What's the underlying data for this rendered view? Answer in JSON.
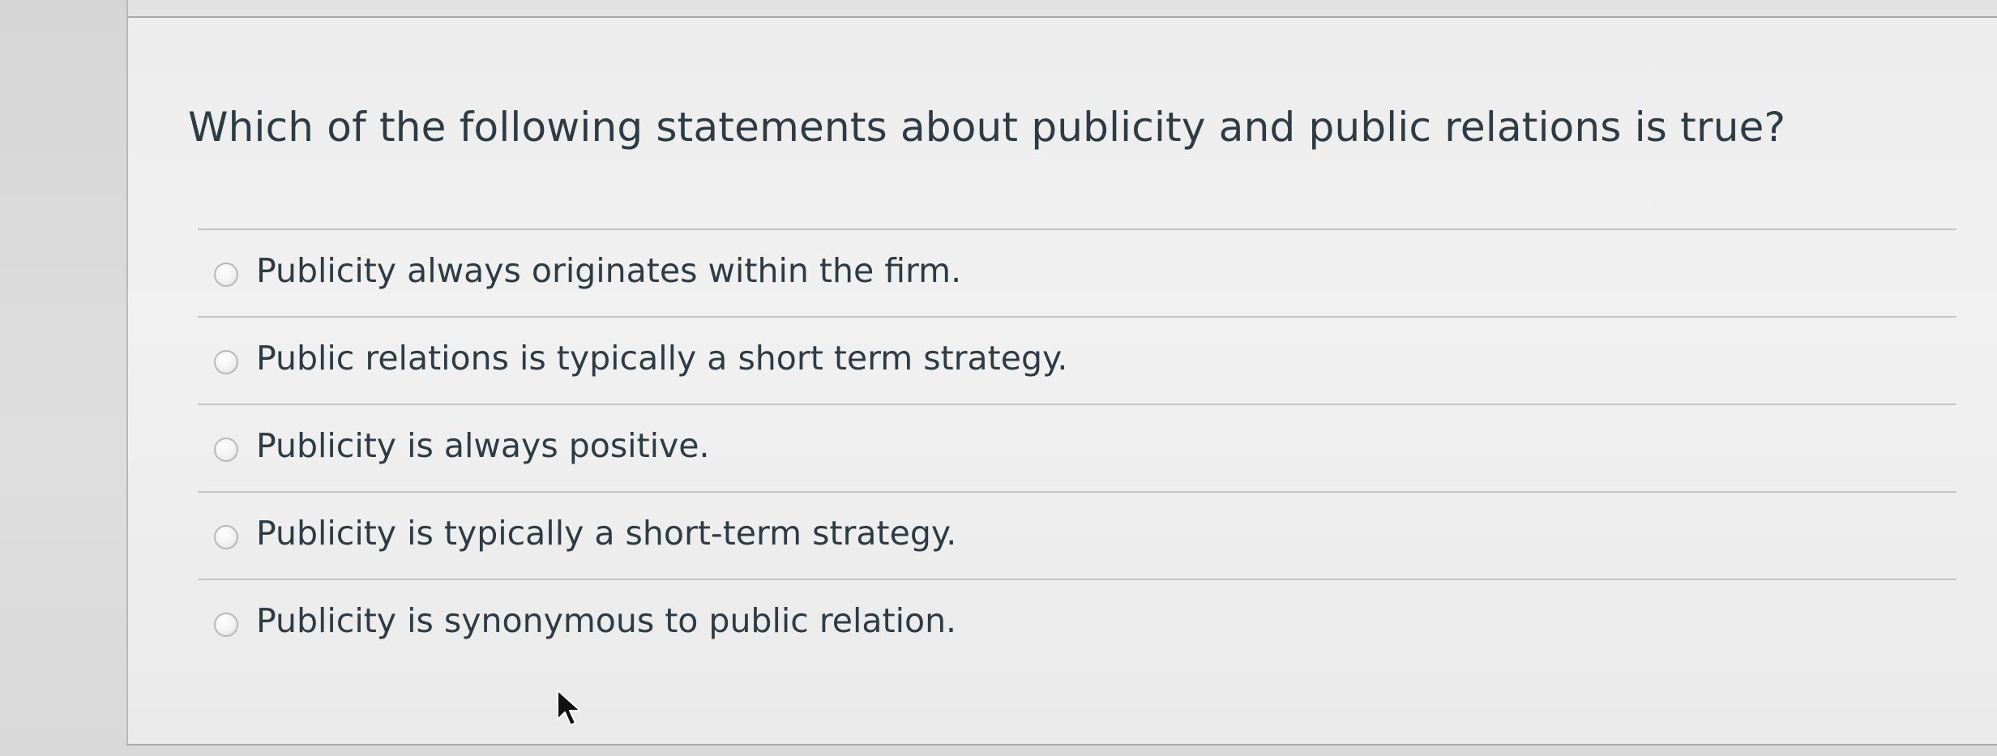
{
  "question": {
    "prompt": "Which of the following statements about publicity and public relations is true?"
  },
  "answers": [
    {
      "label": "Publicity always originates within the firm."
    },
    {
      "label": "Public relations is typically a short term strategy."
    },
    {
      "label": "Publicity is always positive."
    },
    {
      "label": "Publicity is typically a short-term strategy."
    },
    {
      "label": "Publicity is synonymous to public relation."
    }
  ],
  "icons": {
    "cursor": "mouse-pointer-icon",
    "radio": "radio-unselected"
  }
}
